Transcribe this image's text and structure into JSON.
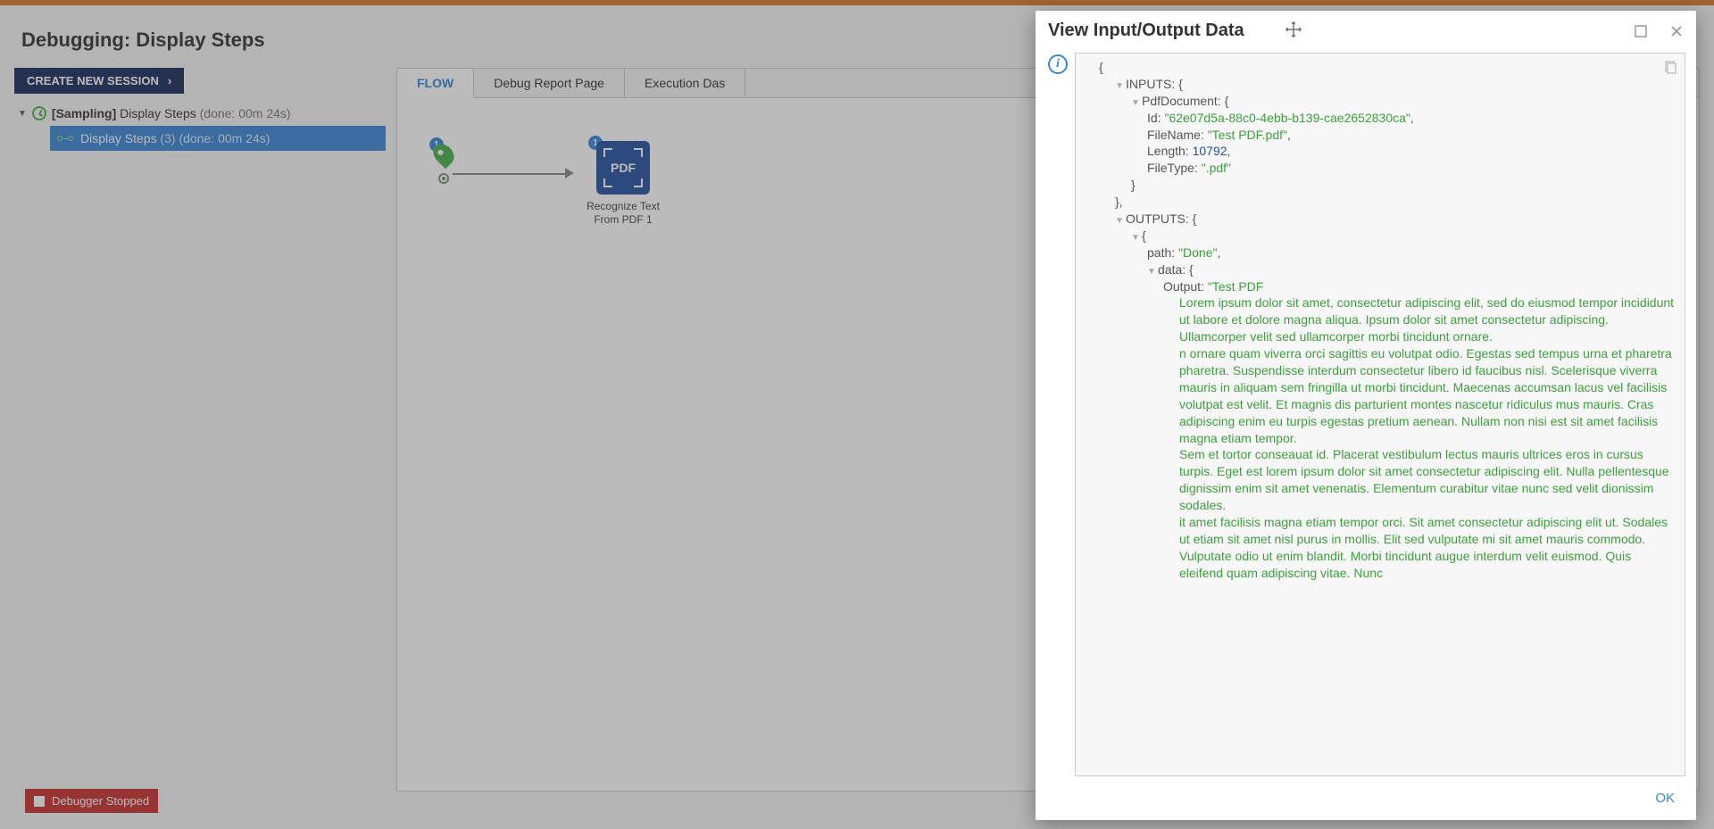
{
  "page": {
    "title": "Debugging: Display Steps",
    "create_session_label": "CREATE NEW SESSION"
  },
  "tree": {
    "root_prefix": "[Sampling] ",
    "root_label": "Display Steps",
    "root_meta": "(done: 00m 24s)",
    "child_label": "Display Steps",
    "child_count": "(3)",
    "child_done": "(done: 00m 24s)"
  },
  "status": {
    "debugger_stopped_label": "Debugger Stopped"
  },
  "tabs": {
    "flow": "FLOW",
    "report": "Debug Report Page",
    "exec": "Execution Das"
  },
  "flow": {
    "start_badge": "1",
    "pdf_badge": "1",
    "pdf_text": "PDF",
    "pdf_label": "Recognize Text From PDF 1"
  },
  "dialog": {
    "title": "View Input/Output Data",
    "ok_label": "OK"
  },
  "json": {
    "open_brace": "{",
    "inputs_label": "INPUTS: {",
    "pdfdoc_label": "PdfDocument: {",
    "id_key": "Id: ",
    "id_val": "\"62e07d5a-88c0-4ebb-b139-cae2652830ca\"",
    "filename_key": "FileName: ",
    "filename_val": "\"Test PDF.pdf\"",
    "length_key": "Length: ",
    "length_val": "10792",
    "filetype_key": "FileType: ",
    "filetype_val": "\".pdf\"",
    "close_brace": "}",
    "close_brace_comma": "},",
    "outputs_label": "OUTPUTS: {",
    "anon_open": "{",
    "path_key": "path: ",
    "path_val": "\"Done\"",
    "data_key": "data: {",
    "output_key": "Output: ",
    "output_val_start": "\"Test PDF",
    "para1": "Lorem ipsum dolor sit amet, consectetur adipiscing elit, sed do eiusmod tempor incididunt ut labore et dolore magna aliqua. Ipsum dolor sit amet consectetur adipiscing. Ullamcorper velit sed ullamcorper morbi tincidunt ornare.",
    "para2": "n ornare quam viverra orci sagittis eu volutpat odio. Egestas sed tempus urna et pharetra pharetra. Suspendisse interdum consectetur libero id faucibus nisl. Scelerisque viverra mauris in aliquam sem fringilla ut morbi tincidunt. Maecenas accumsan lacus vel facilisis volutpat est velit. Et magnis dis parturient montes nascetur ridiculus mus mauris. Cras adipiscing enim eu turpis egestas pretium aenean. Nullam non nisi est sit amet facilisis magna etiam tempor.",
    "para3": "Sem et tortor conseauat id. Placerat vestibulum lectus mauris ultrices eros in cursus turpis. Eget est lorem ipsum dolor sit amet consectetur adipiscing elit. Nulla pellentesque dignissim enim sit amet venenatis. Elementum curabitur vitae nunc sed velit dionissim sodales.",
    "para4": "it amet facilisis magna etiam tempor orci. Sit amet consectetur adipiscing elit ut. Sodales ut etiam sit amet nisl purus in mollis. Elit sed vulputate mi sit amet mauris commodo. Vulputate odio ut enim blandit. Morbi tincidunt augue interdum velit euismod. Quis eleifend quam adipiscing vitae. Nunc"
  }
}
